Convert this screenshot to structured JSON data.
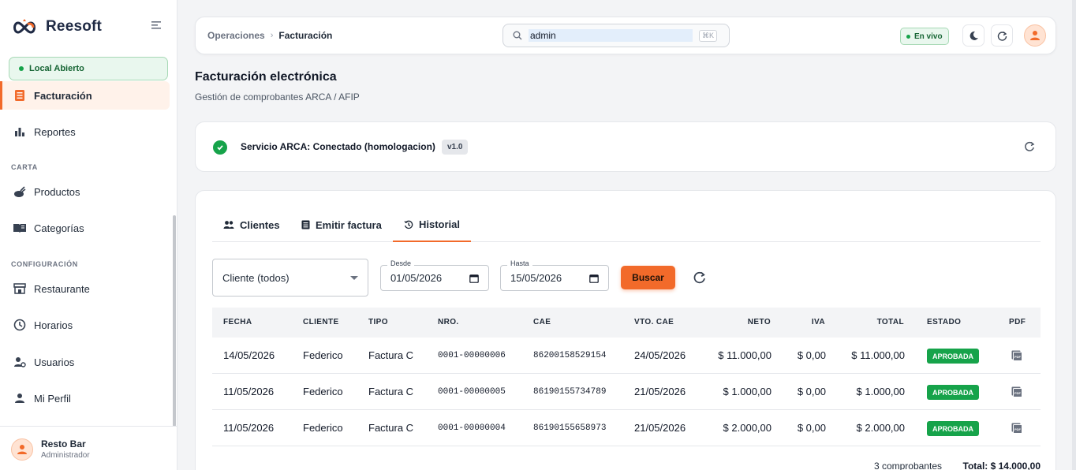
{
  "brand": {
    "name": "Reesoft"
  },
  "sidebar": {
    "status_badge": "Local Abierto",
    "items": [
      {
        "label": "Facturación",
        "icon": "receipt-icon",
        "active": true
      },
      {
        "label": "Reportes",
        "icon": "bar-chart-icon",
        "active": false
      },
      {
        "label": "Productos",
        "icon": "food-icon",
        "active": false
      },
      {
        "label": "Categorías",
        "icon": "book-icon",
        "active": false
      },
      {
        "label": "Restaurante",
        "icon": "store-icon",
        "active": false
      },
      {
        "label": "Horarios",
        "icon": "clock-icon",
        "active": false
      },
      {
        "label": "Usuarios",
        "icon": "users-icon",
        "active": false
      },
      {
        "label": "Mi Perfil",
        "icon": "person-icon",
        "active": false
      }
    ],
    "sections": [
      "CARTA",
      "CONFIGURACIÓN"
    ],
    "user": {
      "name": "Resto Bar",
      "role": "Administrador"
    }
  },
  "topbar": {
    "breadcrumb": {
      "parent": "Operaciones",
      "current": "Facturación"
    },
    "search_value": "admin",
    "search_shortcut": "⌘K",
    "live_label": "En vivo"
  },
  "page": {
    "title": "Facturación electrónica",
    "subtitle": "Gestión de comprobantes ARCA / AFIP"
  },
  "service": {
    "status_text": "Servicio ARCA: Conectado (homologacion)",
    "version": "v1.0"
  },
  "tabs": [
    {
      "label": "Clientes",
      "icon": "people-icon"
    },
    {
      "label": "Emitir factura",
      "icon": "document-icon"
    },
    {
      "label": "Historial",
      "icon": "history-icon",
      "active": true
    }
  ],
  "filters": {
    "client_select": "Cliente (todos)",
    "desde_label": "Desde",
    "desde_value": "01/05/2026",
    "hasta_label": "Hasta",
    "hasta_value": "15/05/2026",
    "search_button": "Buscar"
  },
  "table": {
    "columns": [
      "FECHA",
      "CLIENTE",
      "TIPO",
      "NRO.",
      "CAE",
      "VTO. CAE",
      "NETO",
      "IVA",
      "TOTAL",
      "ESTADO",
      "PDF"
    ],
    "rows": [
      {
        "fecha": "14/05/2026",
        "cliente": "Federico",
        "tipo": "Factura C",
        "nro": "0001-00000006",
        "cae": "86200158529154",
        "vto": "24/05/2026",
        "neto": "$ 11.000,00",
        "iva": "$ 0,00",
        "total": "$ 11.000,00",
        "estado": "APROBADA"
      },
      {
        "fecha": "11/05/2026",
        "cliente": "Federico",
        "tipo": "Factura C",
        "nro": "0001-00000005",
        "cae": "86190155734789",
        "vto": "21/05/2026",
        "neto": "$ 1.000,00",
        "iva": "$ 0,00",
        "total": "$ 1.000,00",
        "estado": "APROBADA"
      },
      {
        "fecha": "11/05/2026",
        "cliente": "Federico",
        "tipo": "Factura C",
        "nro": "0001-00000004",
        "cae": "86190155658973",
        "vto": "21/05/2026",
        "neto": "$ 2.000,00",
        "iva": "$ 0,00",
        "total": "$ 2.000,00",
        "estado": "APROBADA"
      }
    ],
    "footer": {
      "count": "3 comprobantes",
      "total": "Total: $ 14.000,00"
    }
  },
  "colors": {
    "accent": "#f26a2a",
    "success": "#16a34a",
    "brand_dark": "#1f2a44"
  }
}
